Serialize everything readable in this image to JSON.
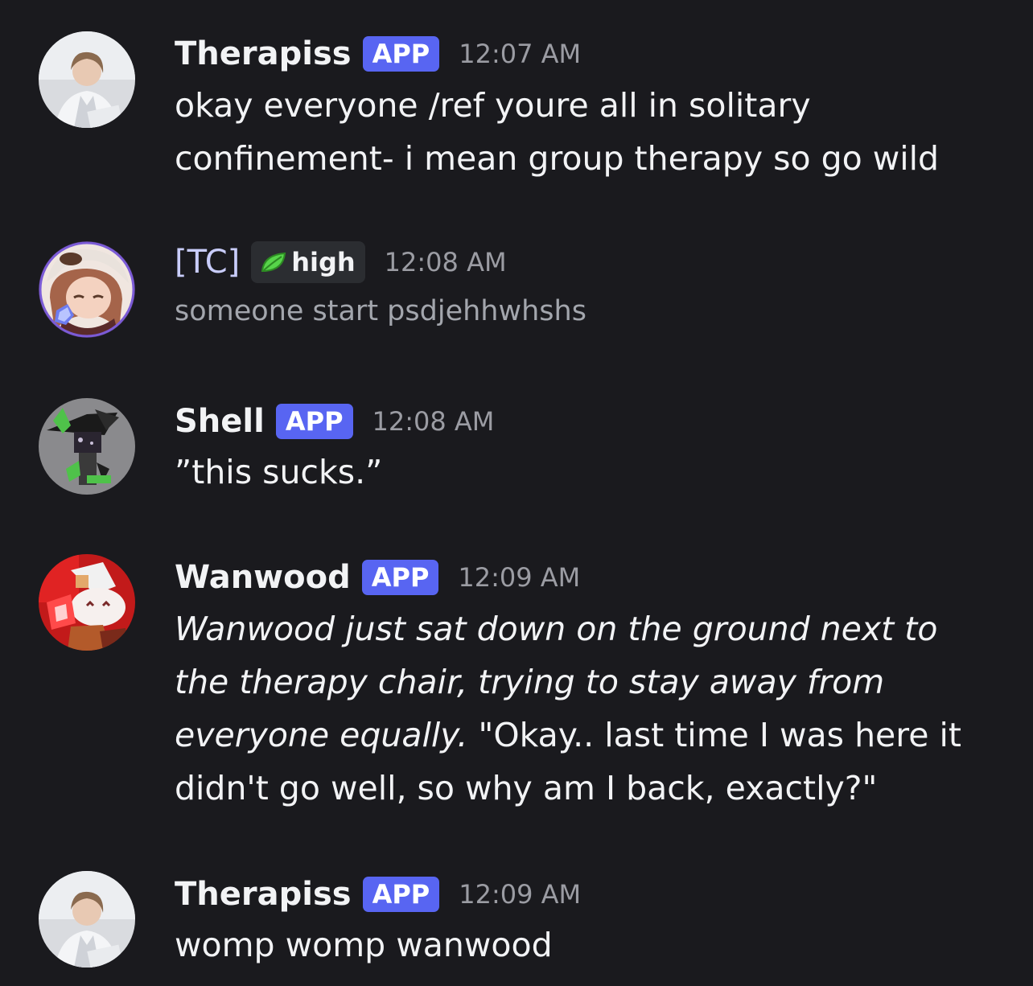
{
  "messages": [
    {
      "username": "Therapiss",
      "tag": "APP",
      "time": "12:07 AM",
      "content": "okay everyone /ref youre all in solitary confinement- i mean group therapy so go wild",
      "avatar_icon": "therapist-avatar"
    },
    {
      "username": "[TC]",
      "role": "high",
      "role_icon": "leaf-icon",
      "time": "12:08 AM",
      "content": "someone start psdjehhwhshs",
      "avatar_icon": "anime-character-avatar"
    },
    {
      "username": "Shell",
      "tag": "APP",
      "time": "12:08 AM",
      "content": "”this sucks.”",
      "avatar_icon": "shell-character-avatar"
    },
    {
      "username": "Wanwood",
      "tag": "APP",
      "time": "12:09 AM",
      "content_italic": "Wanwood just sat down on the ground next to the therapy chair, trying to stay away from everyone equally.",
      "content_plain": " \"Okay.. last time I was here it didn't go well, so why am I back, exactly?\"",
      "avatar_icon": "wanwood-character-avatar"
    },
    {
      "username": "Therapiss",
      "tag": "APP",
      "time": "12:09 AM",
      "content": "womp womp wanwood",
      "avatar_icon": "therapist-avatar"
    }
  ],
  "colors": {
    "background": "#1a1a1e",
    "app_tag": "#5865f2",
    "timestamp": "#9b9ca3",
    "role_leaf": "#57d44a"
  }
}
